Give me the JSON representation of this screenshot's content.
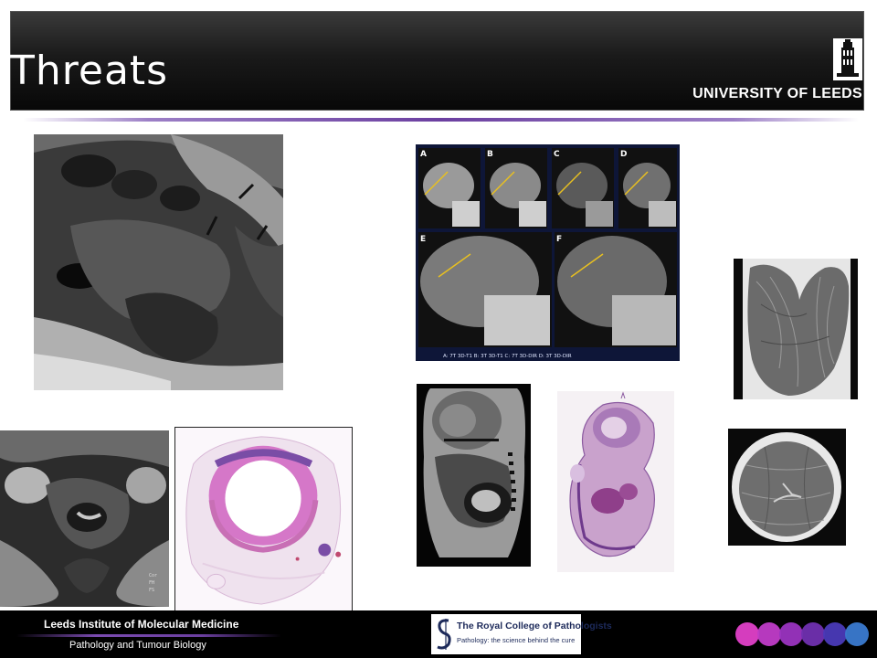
{
  "slide": {
    "title": "Threats"
  },
  "header": {
    "university_logo_text": "UNIVERSITY OF LEEDS"
  },
  "figure_panel": {
    "labels": [
      "A",
      "B",
      "C",
      "D",
      "E",
      "F"
    ],
    "caption": "A: 7T 3D-T1 B: 3T 3D-T1 C: 7T 3D-DIR D: 3T 3D-DIR"
  },
  "mri_scale_labels": [
    "Cor",
    "FH",
    "FS"
  ],
  "footer": {
    "institute": "Leeds Institute of Molecular Medicine",
    "department": "Pathology and Tumour Biology",
    "rcp_name": "The Royal College of Pathologists",
    "rcp_tagline": "Pathology: the science behind the cure"
  },
  "colors": {
    "title_bar": "#141414",
    "accent_purple": "#6b3fa0",
    "stain_pink": "#c86fb5",
    "stain_purple": "#7a4da6",
    "dot_colors": [
      "#e040c8",
      "#c03cc8",
      "#9a34c0",
      "#7030b0",
      "#4a3ab8",
      "#3a7ad0"
    ]
  },
  "icons": {
    "university_crest": "parkinson-tower-icon",
    "rcp_mark": "rcp-s-symbol-icon"
  }
}
